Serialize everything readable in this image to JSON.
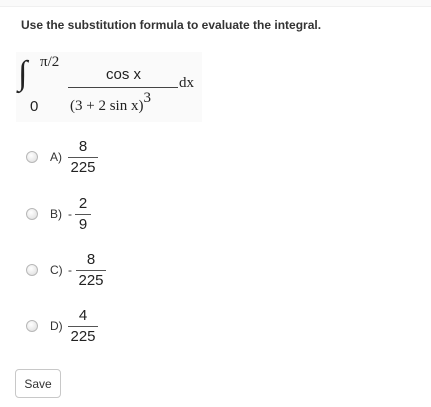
{
  "question": "Use the substitution formula to evaluate the integral.",
  "integral": {
    "sign": "∫",
    "upper_limit": "π/2",
    "lower_limit": "0",
    "numerator": "cos x",
    "denominator": "(3  + 2 sin x)",
    "exponent": "3",
    "differential": "dx"
  },
  "options": [
    {
      "label": "A)",
      "sign": "",
      "numerator": "8",
      "denominator": "225"
    },
    {
      "label": "B)",
      "sign": "-",
      "numerator": "2",
      "denominator": "9"
    },
    {
      "label": "C)",
      "sign": "-",
      "numerator": "8",
      "denominator": "225"
    },
    {
      "label": "D)",
      "sign": "",
      "numerator": "4",
      "denominator": "225"
    }
  ],
  "save_label": "Save"
}
